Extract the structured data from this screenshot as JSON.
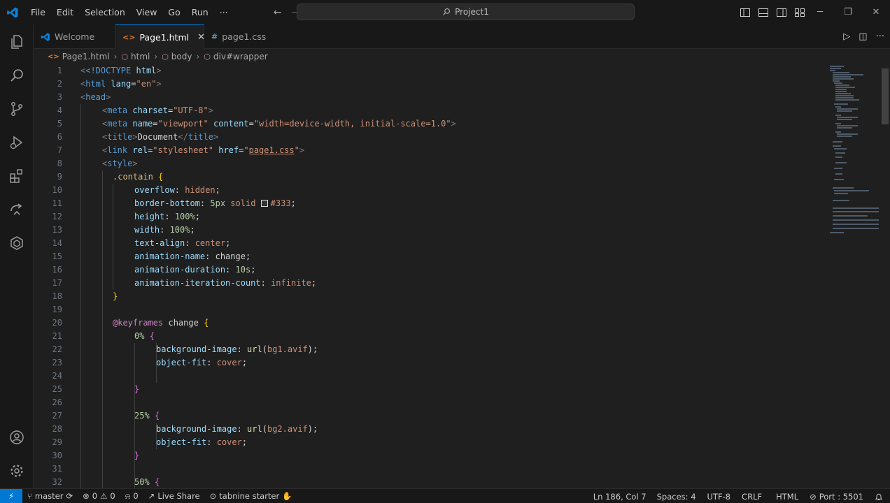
{
  "titlebar": {
    "menu": [
      "File",
      "Edit",
      "Selection",
      "View",
      "Go",
      "Run",
      "···"
    ],
    "search_text": "Project1"
  },
  "tabs": [
    {
      "label": "Welcome",
      "icon": "vscode-logo-icon"
    },
    {
      "label": "Page1.html",
      "icon": "html-file-icon",
      "active": true
    },
    {
      "label": "page1.css",
      "icon": "css-file-icon"
    }
  ],
  "breadcrumb": [
    "Page1.html",
    "html",
    "body",
    "div#wrapper"
  ],
  "editor": {
    "lines": [
      {
        "n": "1"
      },
      {
        "n": "2"
      },
      {
        "n": "3"
      },
      {
        "n": "4"
      },
      {
        "n": "5"
      },
      {
        "n": "6"
      },
      {
        "n": "7"
      },
      {
        "n": "8"
      },
      {
        "n": "9"
      },
      {
        "n": "10"
      },
      {
        "n": "11"
      },
      {
        "n": "12"
      },
      {
        "n": "13"
      },
      {
        "n": "14"
      },
      {
        "n": "15"
      },
      {
        "n": "16"
      },
      {
        "n": "17"
      },
      {
        "n": "18"
      },
      {
        "n": "19"
      },
      {
        "n": "20"
      },
      {
        "n": "21"
      },
      {
        "n": "22"
      },
      {
        "n": "23"
      },
      {
        "n": "24"
      },
      {
        "n": "25"
      },
      {
        "n": "26"
      },
      {
        "n": "27"
      },
      {
        "n": "28"
      },
      {
        "n": "29"
      },
      {
        "n": "30"
      },
      {
        "n": "31"
      },
      {
        "n": "32"
      }
    ],
    "code": {
      "l1_doctype": "<!DOCTYPE",
      "l1_html": "html",
      "l2_tag": "html",
      "l2_attr": "lang",
      "l2_val": "\"en\"",
      "l3_tag": "head",
      "l4_tag": "meta",
      "l4_attr": "charset",
      "l4_val": "\"UTF-8\"",
      "l5_tag": "meta",
      "l5_attr1": "name",
      "l5_val1": "\"viewport\"",
      "l5_attr2": "content",
      "l5_val2": "\"width=device-width, initial-scale=1.0\"",
      "l6_tag": "title",
      "l6_text": "Document",
      "l7_tag": "link",
      "l7_attr1": "rel",
      "l7_val1": "\"stylesheet\"",
      "l7_attr2": "href",
      "l7_val2": "page1.css",
      "l8_tag": "style",
      "l9_sel": ".contain",
      "l10_prop": "overflow",
      "l10_val": "hidden",
      "l11_prop": "border-bottom",
      "l11_num": "5px",
      "l11_val": "solid",
      "l11_color": "#333",
      "l12_prop": "height",
      "l12_num": "100%",
      "l13_prop": "width",
      "l13_num": "100%",
      "l14_prop": "text-align",
      "l14_val": "center",
      "l15_prop": "animation-name",
      "l15_val": "change",
      "l16_prop": "animation-duration",
      "l16_num": "10s",
      "l17_prop": "animation-iteration-count",
      "l17_val": "infinite",
      "l20_at": "@keyframes",
      "l20_name": "change",
      "l21_sel": "0%",
      "l22_prop": "background-image",
      "l22_fn": "url",
      "l22_arg": "bg1.avif",
      "l23_prop": "object-fit",
      "l23_val": "cover",
      "l27_sel": "25%",
      "l28_prop": "background-image",
      "l28_fn": "url",
      "l28_arg": "bg2.avif",
      "l29_prop": "object-fit",
      "l29_val": "cover",
      "l32_sel": "50%"
    }
  },
  "statusbar": {
    "branch": "master",
    "errors": "0",
    "warnings": "0",
    "ports": "0",
    "live_share": "Live Share",
    "tabnine": "tabnine starter",
    "position": "Ln 186, Col 7",
    "spaces": "Spaces: 4",
    "encoding": "UTF-8",
    "eol": "CRLF",
    "language": "HTML",
    "port": "Port : 5501"
  },
  "colors": {
    "accent": "#0078d4",
    "background": "#1f1f1f",
    "chrome": "#181818"
  }
}
